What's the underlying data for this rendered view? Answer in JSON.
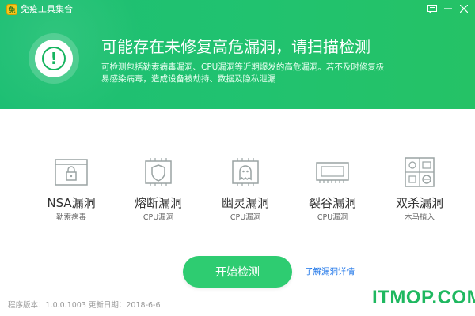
{
  "window": {
    "title": "免疫工具集合",
    "buttons": {
      "feedback_icon": "feedback-icon",
      "minimize_icon": "minimize-icon",
      "close_icon": "close-icon"
    }
  },
  "alert": {
    "headline": "可能存在未修复高危漏洞，请扫描检测",
    "description": "可检测包括勒索病毒漏洞、CPU漏洞等近期爆发的高危漏洞。若不及时修复极易感染病毒，造成设备被劫持、数据及隐私泄漏"
  },
  "vulnerabilities": [
    {
      "name": "NSA漏洞",
      "sub": "勒索病毒",
      "icon": "lock-window-icon"
    },
    {
      "name": "熔断漏洞",
      "sub": "CPU漏洞",
      "icon": "shield-chip-icon"
    },
    {
      "name": "幽灵漏洞",
      "sub": "CPU漏洞",
      "icon": "ghost-chip-icon"
    },
    {
      "name": "裂谷漏洞",
      "sub": "CPU漏洞",
      "icon": "memory-card-icon"
    },
    {
      "name": "双杀漏洞",
      "sub": "木马植入",
      "icon": "browser-grid-icon"
    }
  ],
  "actions": {
    "scan_label": "开始检测",
    "details_link": "了解漏洞详情"
  },
  "footer": {
    "version": "程序版本：1.0.0.1003 更新日期：2018-6-6",
    "watermark": "ITMOP.COM"
  },
  "colors": {
    "brand_green": "#21c26f",
    "button_green": "#2ecc71",
    "link_blue": "#1a73e8",
    "icon_gray": "#9aa3a3"
  }
}
